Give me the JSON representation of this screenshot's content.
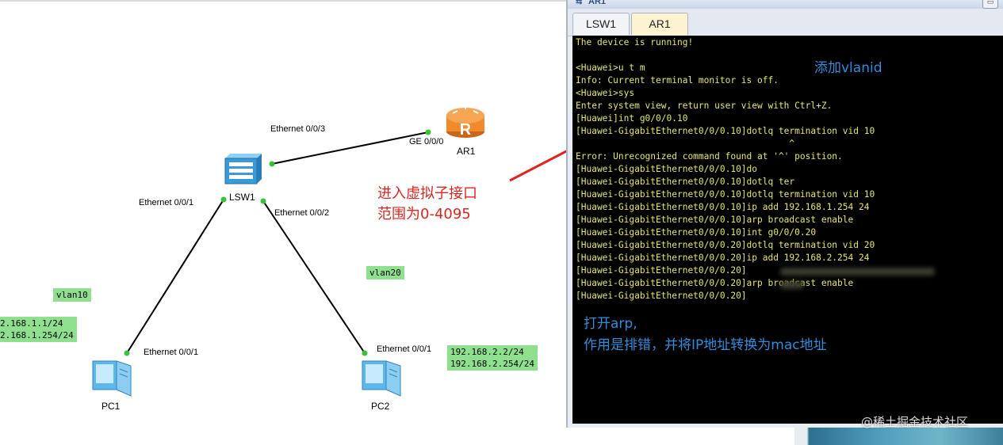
{
  "topology": {
    "devices": {
      "router": {
        "name": "AR1",
        "icon": "router-icon",
        "color": "#f08a2a"
      },
      "switch": {
        "name": "LSW1",
        "icon": "switch-icon",
        "color": "#3a9ad9"
      },
      "pc1": {
        "name": "PC1",
        "icon": "pc-icon"
      },
      "pc2": {
        "name": "PC2",
        "icon": "pc-icon"
      }
    },
    "ports": {
      "sw_to_router": "Ethernet 0/0/3",
      "router_port": "GE 0/0/0",
      "sw_to_pc1": "Ethernet 0/0/1",
      "sw_to_pc2": "Ethernet 0/0/2",
      "pc1_port": "Ethernet 0/0/1",
      "pc2_port": "Ethernet 0/0/1"
    },
    "notes": {
      "vlan10": "vlan10",
      "vlan20": "vlan20",
      "pc1_ip": "2.168.1.1/24",
      "pc1_gw": "2.168.1.254/24",
      "pc2_ip": "192.168.2.2/24",
      "pc2_gw": "192.168.2.254/24"
    },
    "link_color": "#000000",
    "port_dot_color": "#35c435"
  },
  "annotations": {
    "red_line1": "进入虚拟子接口",
    "red_line2": "范围为0-4095",
    "blue_top": "添加vlanid",
    "blue_bottom_line1": "打开arp,",
    "blue_bottom_line2": "作用是排错，并将IP地址转换为mac地址",
    "arrow_color": "#e5231b"
  },
  "window": {
    "title": "AR1",
    "title_icon": "ensp-app-icon",
    "tabs": [
      {
        "label": "LSW1",
        "active": false
      },
      {
        "label": "AR1",
        "active": true
      }
    ],
    "terminal": {
      "text_color": "#e8e85a",
      "background": "#000000",
      "lines": [
        "The device is running!",
        "",
        "<Huawei>u t m",
        "Info: Current terminal monitor is off.",
        "<Huawei>sys",
        "Enter system view, return user view with Ctrl+Z.",
        "[Huawei]int g0/0/0.10",
        "[Huawei-GigabitEthernet0/0/0.10]dotlq termination vid 10",
        "                                        ^",
        "Error: Unrecognized command found at '^' position.",
        "[Huawei-GigabitEthernet0/0/0.10]do",
        "[Huawei-GigabitEthernet0/0/0.10]dotlq ter",
        "[Huawei-GigabitEthernet0/0/0.10]dotlq termination vid 10",
        "[Huawei-GigabitEthernet0/0/0.10]ip add 192.168.1.254 24",
        "[Huawei-GigabitEthernet0/0/0.10]arp broadcast enable",
        "[Huawei-GigabitEthernet0/0/0.10]int g0/0/0.20",
        "[Huawei-GigabitEthernet0/0/0.20]dotlq termination vid 20",
        "[Huawei-GigabitEthernet0/0/0.20]ip add 192.168.2.254 24",
        "[Huawei-GigabitEthernet0/0/0.20]",
        "[Huawei-GigabitEthernet0/0/0.20]arp broadcast enable",
        "[Huawei-GigabitEthernet0/0/0.20]"
      ]
    }
  },
  "watermark": "@稀土掘金技术社区"
}
